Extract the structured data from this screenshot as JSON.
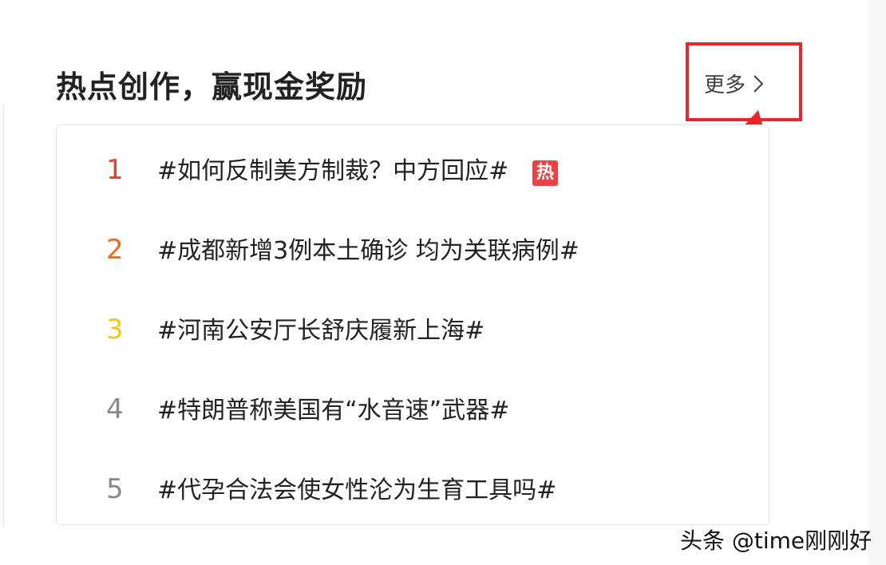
{
  "section": {
    "title": "热点创作，赢现金奖励",
    "more_label": "更多",
    "more_icon": "chevron-right-icon"
  },
  "hot_list": [
    {
      "rank": "1",
      "topic": "#如何反制美方制裁？中方回应#",
      "badge": "热",
      "rank_color": "#e33e33"
    },
    {
      "rank": "2",
      "topic": "#成都新增3例本土确诊 均为关联病例#",
      "badge": "",
      "rank_color": "#f26b1d"
    },
    {
      "rank": "3",
      "topic": "#河南公安厅长舒庆履新上海#",
      "badge": "",
      "rank_color": "#f5c518"
    },
    {
      "rank": "4",
      "topic": "#特朗普称美国有“水音速”武器#",
      "badge": "",
      "rank_color": "#888890"
    },
    {
      "rank": "5",
      "topic": "#代孕合法会使女性沦为生育工具吗#",
      "badge": "",
      "rank_color": "#888890"
    }
  ],
  "annotation": {
    "box_color": "#e9262a"
  },
  "watermark": "头条 @time刚刚好"
}
